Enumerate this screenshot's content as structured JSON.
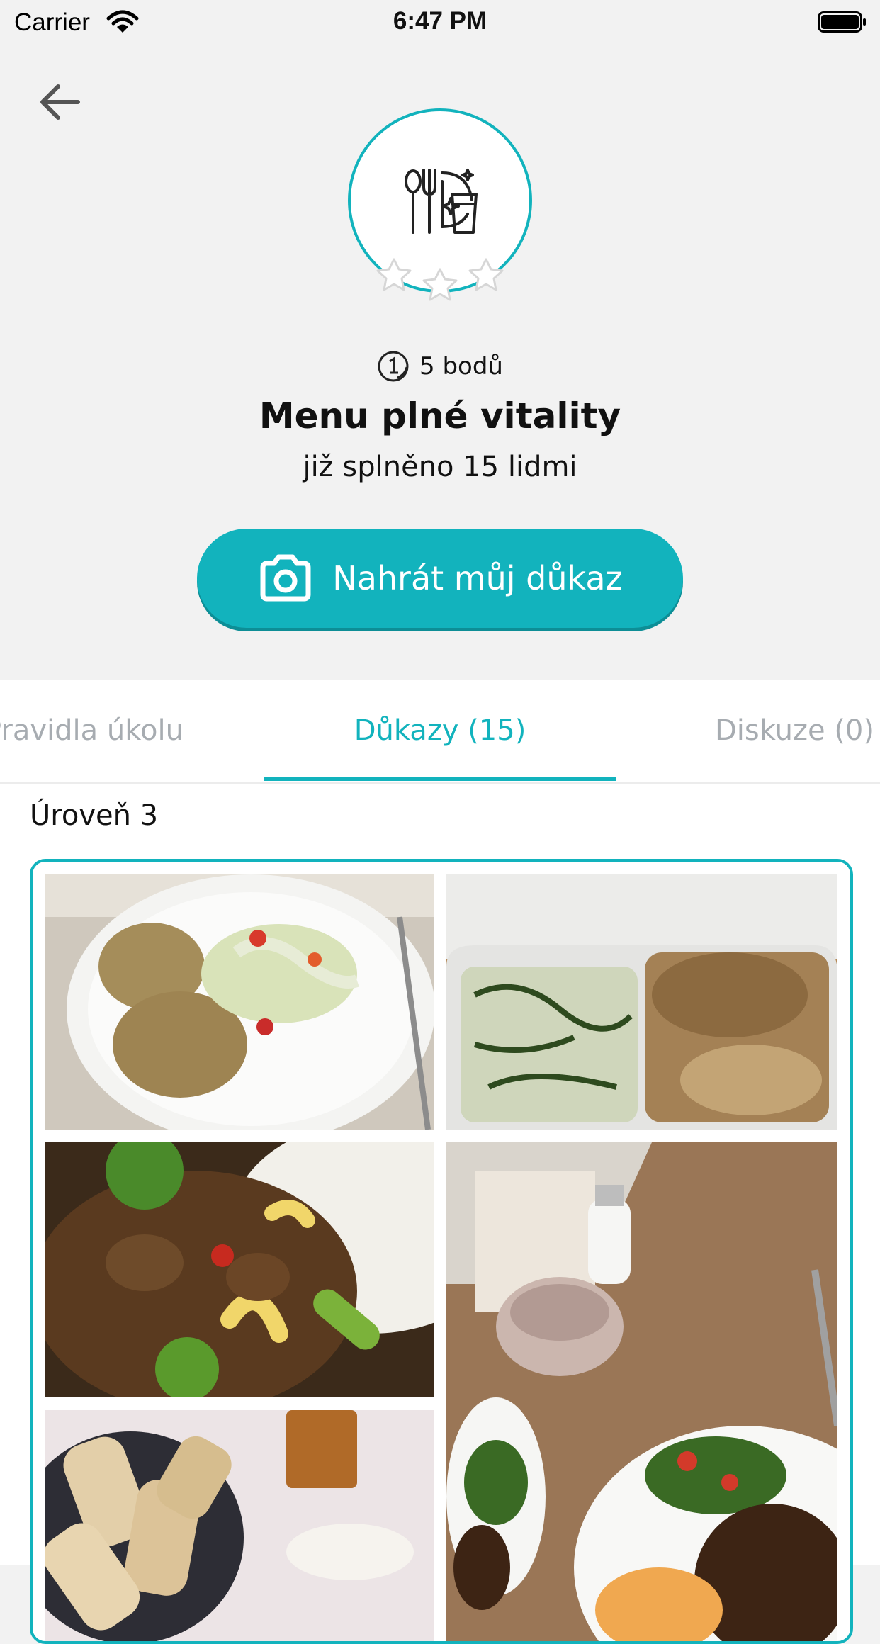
{
  "status_bar": {
    "carrier": "Carrier",
    "time": "6:47 PM"
  },
  "challenge": {
    "points": "5 bodů",
    "title": "Menu plné vitality",
    "subtitle": "již splněno 15 lidmi",
    "upload_label": "Nahrát můj důkaz"
  },
  "tabs": [
    {
      "label": "Pravidla úkolu"
    },
    {
      "label": "Důkazy (15)"
    },
    {
      "label": "Diskuze (0)"
    }
  ],
  "content": {
    "level": "Úroveň 3"
  },
  "colors": {
    "accent": "#12b3bd",
    "background": "#f2f2f2"
  },
  "icons": [
    "back-arrow-icon",
    "dining-icon",
    "star-icon",
    "coin-icon",
    "camera-icon"
  ]
}
